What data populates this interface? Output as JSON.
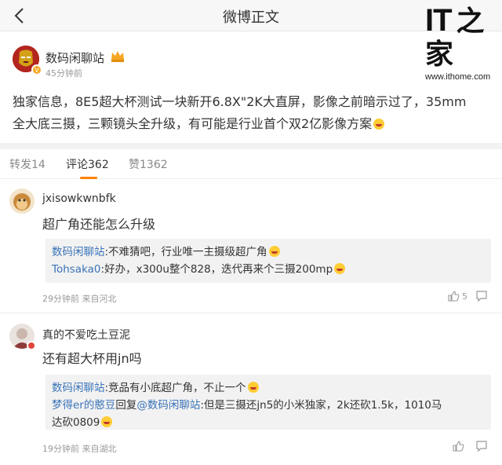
{
  "header": {
    "title": "微博正文",
    "watermark_logo": "IT之家",
    "watermark_logo_it": "IT",
    "watermark_logo_han": "之家",
    "watermark_url": "www.ithome.com"
  },
  "post": {
    "user": "数码闲聊站",
    "time": "45分钟前",
    "text_line1": "独家信息，8E5超大杯测试一块新开6.8X\"2K大直屏，影像之前暗示过了，35mm",
    "text_line2": "全大底三摄，三颗镜头全升级，有可能是行业首个双2亿影像方案"
  },
  "tabs": [
    {
      "label": "转发14"
    },
    {
      "label": "评论362"
    },
    {
      "label": "赞1362"
    }
  ],
  "comments": [
    {
      "user": "jxisowkwnbfk",
      "text": "超广角还能怎么升级",
      "replies": [
        {
          "user": "数码闲聊站",
          "text": ":不难猜吧，行业唯一主摄级超广角"
        },
        {
          "user": "Tohsaka0",
          "text": ":好办，x300u整个828，迭代再来个三摄200mp"
        }
      ],
      "time": "29分钟前",
      "location": "来自河北",
      "likes": "5"
    },
    {
      "user": "真的不爱吃土豆泥",
      "text": "还有超大杯用jn吗",
      "replies": [
        {
          "user": "数码闲聊站",
          "text": ":竞品有小底超广角，不止一个"
        },
        {
          "user": "梦得er的憨豆",
          "mid": "回复",
          "mention": "@数码闲聊站",
          "text": ":但是三摄还jn5的小米独家，2k还砍1.5k，1010马",
          "text2": "达砍0809"
        }
      ],
      "time": "19分钟前",
      "location": "来自湖北"
    }
  ],
  "colors": {
    "accent": "#ff8200",
    "link": "#3a74b8",
    "meta": "#999999",
    "reply_bg": "#f2f2f2"
  }
}
